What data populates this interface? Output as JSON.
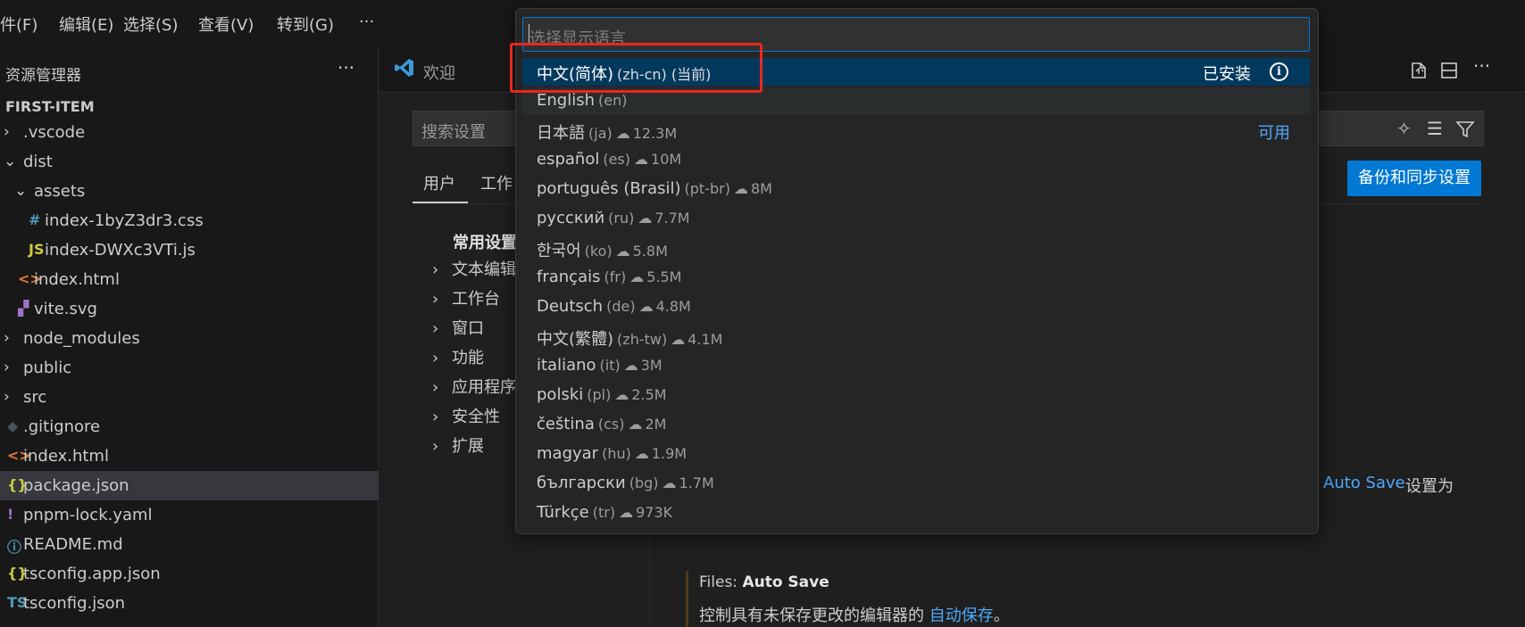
{
  "menubar": {
    "items": [
      "件(F)",
      "编辑(E)",
      "选择(S)",
      "查看(V)",
      "转到(G)",
      "···"
    ]
  },
  "sidebar": {
    "title": "资源管理器",
    "more": "···",
    "project": "FIRST-ITEM",
    "tree": [
      {
        "label": ".vscode",
        "kind": "folder",
        "expanded": false
      },
      {
        "label": "dist",
        "kind": "folder",
        "expanded": true
      },
      {
        "label": "assets",
        "kind": "folder",
        "expanded": true
      },
      {
        "label": "index-1byZ3dr3.css",
        "kind": "css",
        "icon": "#"
      },
      {
        "label": "index-DWXc3VTi.js",
        "kind": "js",
        "icon": "JS"
      },
      {
        "label": "index.html",
        "kind": "html",
        "icon": "<>"
      },
      {
        "label": "vite.svg",
        "kind": "svg",
        "icon": "▞"
      },
      {
        "label": "node_modules",
        "kind": "folder",
        "expanded": false
      },
      {
        "label": "public",
        "kind": "folder",
        "expanded": false
      },
      {
        "label": "src",
        "kind": "folder",
        "expanded": false
      },
      {
        "label": ".gitignore",
        "kind": "git",
        "icon": "◆"
      },
      {
        "label": "index.html",
        "kind": "html",
        "icon": "<>"
      },
      {
        "label": "package.json",
        "kind": "json",
        "icon": "{}",
        "selected": true
      },
      {
        "label": "pnpm-lock.yaml",
        "kind": "yaml",
        "icon": "!"
      },
      {
        "label": "README.md",
        "kind": "info",
        "icon": "ⓘ"
      },
      {
        "label": "tsconfig.app.json",
        "kind": "json",
        "icon": "{}"
      },
      {
        "label": "tsconfig.json",
        "kind": "ts",
        "icon": "TS"
      }
    ]
  },
  "editor": {
    "tab_label": "欢迎",
    "search_placeholder": "搜索设置",
    "settings_tabs": [
      "用户",
      "工作"
    ],
    "sync_button": "备份和同步设置",
    "toc_heading": "常用设置",
    "toc_items": [
      "文本编辑",
      "工作台",
      "窗口",
      "功能",
      "应用程序",
      "安全性",
      "扩展"
    ],
    "autosave_link": "Auto Save",
    "autosave_tail": "设置为",
    "setting_title_prefix": "Files: ",
    "setting_title_name": "Auto Save",
    "setting_desc_prefix": "控制具有未保存更改的编辑器的",
    "setting_desc_link": "自动保存",
    "setting_desc_suffix": "。"
  },
  "picker": {
    "placeholder": "选择显示语言",
    "installed_label": "已安装",
    "available_label": "可用",
    "languages": [
      {
        "name": "中文(简体)",
        "code": "(zh-cn) (当前)",
        "state": "active"
      },
      {
        "name": "English",
        "code": "(en)",
        "state": "hover"
      },
      {
        "name": "日本語",
        "code": "(ja)",
        "size": "12.3M",
        "available": true
      },
      {
        "name": "español",
        "code": "(es)",
        "size": "10M"
      },
      {
        "name": "português (Brasil)",
        "code": "(pt-br)",
        "size": "8M"
      },
      {
        "name": "русский",
        "code": "(ru)",
        "size": "7.7M"
      },
      {
        "name": "한국어",
        "code": "(ko)",
        "size": "5.8M"
      },
      {
        "name": "français",
        "code": "(fr)",
        "size": "5.5M"
      },
      {
        "name": "Deutsch",
        "code": "(de)",
        "size": "4.8M"
      },
      {
        "name": "中文(繁體)",
        "code": "(zh-tw)",
        "size": "4.1M"
      },
      {
        "name": "italiano",
        "code": "(it)",
        "size": "3M"
      },
      {
        "name": "polski",
        "code": "(pl)",
        "size": "2.5M"
      },
      {
        "name": "čeština",
        "code": "(cs)",
        "size": "2M"
      },
      {
        "name": "magyar",
        "code": "(hu)",
        "size": "1.9M"
      },
      {
        "name": "български",
        "code": "(bg)",
        "size": "1.7M"
      },
      {
        "name": "Türkçe",
        "code": "(tr)",
        "size": "973K"
      }
    ]
  },
  "colors": {
    "accent": "#0078d4",
    "active_row": "#04395e",
    "link": "#4daafc",
    "highlight_box": "#e8281e"
  }
}
